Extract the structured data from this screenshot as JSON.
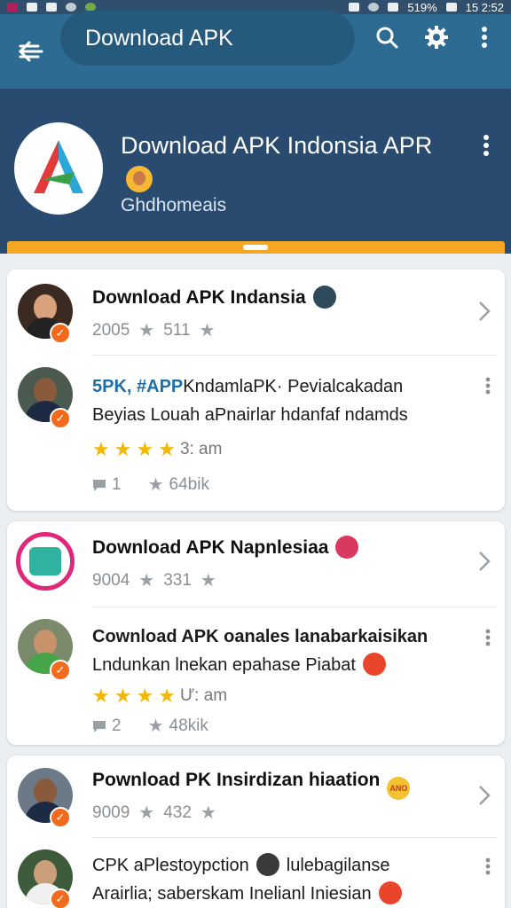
{
  "status_bar": {
    "battery": "519%",
    "time": "15 2:52"
  },
  "appbar": {
    "search_text": "Download APK"
  },
  "header": {
    "title": "Download APK Indonsia APR",
    "subtitle": "Ghdhomeais",
    "progress": 1.0
  },
  "card1": {
    "item1": {
      "title": "Download APK Indansia",
      "count1": "2005",
      "count2": "511"
    },
    "post": {
      "hashtags": "5PK, #APP",
      "line1": "KndamlaPK· Pevialcakadan",
      "line2": "Beyias Louah aPnairlar hdanfaf ndamds",
      "rating_text": "3: am",
      "comments": "1",
      "shares": "64bik"
    }
  },
  "card2": {
    "item1": {
      "title": "Download APK Napnlesiaa",
      "count1": "9004",
      "count2": "331"
    },
    "post": {
      "line1": "Cownload APK oanales lanabarkaisikan",
      "line2": "Lndunkan lnekan epahase Piabat",
      "rating_text": "Ư: am",
      "comments": "2",
      "shares": "48kik"
    }
  },
  "card3": {
    "item1": {
      "title": "Pownload PK Insirdizan hiaation",
      "count1": "9009",
      "count2": "432",
      "badge": "ANO"
    },
    "post": {
      "line1a": "CPK  aPlestoypction",
      "line1b": "lulebagilanse",
      "line2": "Arairlia; saberskam Inelianl Iniesian"
    }
  },
  "colors": {
    "appbar": "#2e6b92",
    "header": "#2a4b70",
    "progress": "#f5a623",
    "check_badge": "#f26b1d",
    "star": "#f2b705"
  }
}
